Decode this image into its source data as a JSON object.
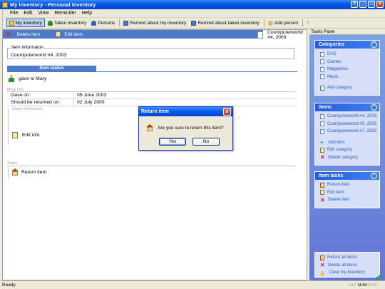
{
  "window": {
    "title": "My inventory - Personal Inventory"
  },
  "menu": [
    "File",
    "Edit",
    "View",
    "Reminder",
    "Help"
  ],
  "toolbar": {
    "my_inventory": "My inventory",
    "taken_inventory": "Taken inventory",
    "persons": "Persons",
    "remind_my": "Remind about my inventory",
    "remind_taken": "Remind about taken inventory",
    "add_person": "Add person",
    "help": "?"
  },
  "item_header": {
    "delete_label": "Delete item",
    "edit_label": "Edit item",
    "doc_line1": "Coumputerworld",
    "doc_line2": "#4, 2003"
  },
  "item_info": {
    "legend": "Item informaion",
    "value": "Coumputerworld #4, 2003"
  },
  "item_status": {
    "header": "Item status",
    "text": "gave to Mary"
  },
  "more_info": {
    "label": "More info",
    "rows": [
      {
        "key": "Gave on:",
        "value": "05 June 2003"
      },
      {
        "key": "Should be returned on:",
        "value": "02 July 2003"
      }
    ]
  },
  "some_info": {
    "label": "Some information",
    "edit_info": "Edit info"
  },
  "tasks": {
    "label": "Tasks",
    "return_item": "Return item"
  },
  "dialog": {
    "title": "Return item",
    "message": "Are you sure to return this item?",
    "yes": "Yes",
    "no": "No"
  },
  "task_pane": {
    "title": "Tasks Pane",
    "categories": {
      "header": "Categories",
      "items": [
        "DVD",
        "Games",
        "Magazines",
        "Music"
      ],
      "add": "Add category"
    },
    "items": {
      "header": "Items",
      "items": [
        "Coumputerworld #4, 2003",
        "Coumputerworld #5, 2003",
        "Coumputerworld #7, 2003"
      ],
      "add_item": "Add item",
      "edit_category": "Edit category",
      "delete_category": "Delete category"
    },
    "item_tasks": {
      "header": "Item tasks",
      "return_item": "Return item",
      "edit_item": "Edit item",
      "delete_item": "Delete item"
    },
    "bottom": {
      "return_all": "Return all items",
      "delete_all": "Delete all items",
      "clear": "Clear my inventory"
    }
  },
  "statusbar": {
    "text": "Ready",
    "cap": "CAP",
    "num": "NUM",
    "scrl": "SCRL"
  },
  "colors": {
    "accent": "#4D7BC9",
    "titlebar": "#0A5AE8",
    "task_pane": "#6F8CDE",
    "link": "#215DC6"
  }
}
